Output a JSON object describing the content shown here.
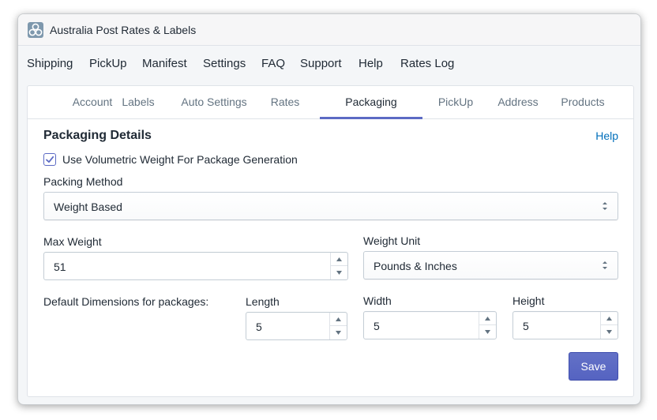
{
  "app": {
    "title": "Australia Post Rates & Labels",
    "logo_icon": "hexagon-cluster-icon"
  },
  "topnav": [
    "Shipping",
    "PickUp",
    "Manifest",
    "Settings",
    "FAQ",
    "Support",
    "Help",
    "Rates Log"
  ],
  "tabs": [
    "Account",
    "Labels",
    "Auto Settings",
    "Rates",
    "Packaging",
    "PickUp",
    "Address",
    "Products"
  ],
  "active_tab": "Packaging",
  "colors": {
    "accent": "#5c6ac4",
    "link": "#006fbb",
    "text": "#212b36",
    "muted": "#637381"
  },
  "packaging": {
    "title": "Packaging Details",
    "help": "Help",
    "volumetric_label": "Use Volumetric Weight For Package Generation",
    "volumetric_checked": true,
    "packing_method_label": "Packing Method",
    "packing_method_value": "Weight Based",
    "max_weight_label": "Max Weight",
    "max_weight_value": "51",
    "weight_unit_label": "Weight Unit",
    "weight_unit_value": "Pounds & Inches",
    "dimensions_label": "Default Dimensions for packages:",
    "length_label": "Length",
    "length_value": "5",
    "width_label": "Width",
    "width_value": "5",
    "height_label": "Height",
    "height_value": "5",
    "save": "Save"
  }
}
